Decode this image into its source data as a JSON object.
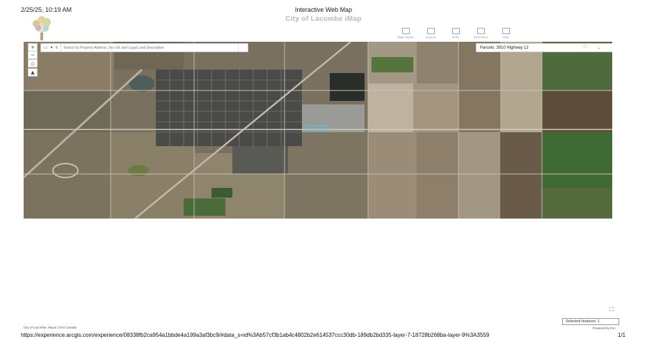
{
  "print_header": {
    "date": "2/25/25, 10:19 AM",
    "title": "Interactive Web Map"
  },
  "app": {
    "title": "City of Lacombe iMap"
  },
  "toolbar": {
    "items": [
      {
        "label": "Map Layers",
        "icon": "layers-icon"
      },
      {
        "label": "Legend",
        "icon": "legend-icon"
      },
      {
        "label": "Print",
        "icon": "print-icon"
      },
      {
        "label": "Directions",
        "icon": "directions-icon"
      },
      {
        "label": "Help",
        "icon": "help-icon"
      }
    ]
  },
  "map": {
    "zoom_in": "+",
    "zoom_out": "−",
    "search": {
      "placeholder": "Search by Property Address, Tax roll, and Legal Land Description"
    },
    "popup": {
      "title": "Parcels: 3910 Highway 12"
    }
  },
  "footer": {
    "credits": "City of Lacombe, Maxar | Esri Canada",
    "powered": "Powered by Esri",
    "selected_features": "Selected features: 1",
    "expand_icon": "expand-icon"
  },
  "print_footer": {
    "url": "https://experience.arcgis.com/experience/08338fb2ca954a1bbde4a199a3af3bc9/#data_s=id%3Ab57cf3b1ab4c4802b2e614537ccc30db-189db2bd335-layer-7-18728b268ba-layer-9%3A3559",
    "page": "1/1"
  },
  "colors": {
    "highlight": "#4fc3e0",
    "popup_border": "#d0d0d0",
    "toolbar_icon": "#9aa7c4"
  }
}
